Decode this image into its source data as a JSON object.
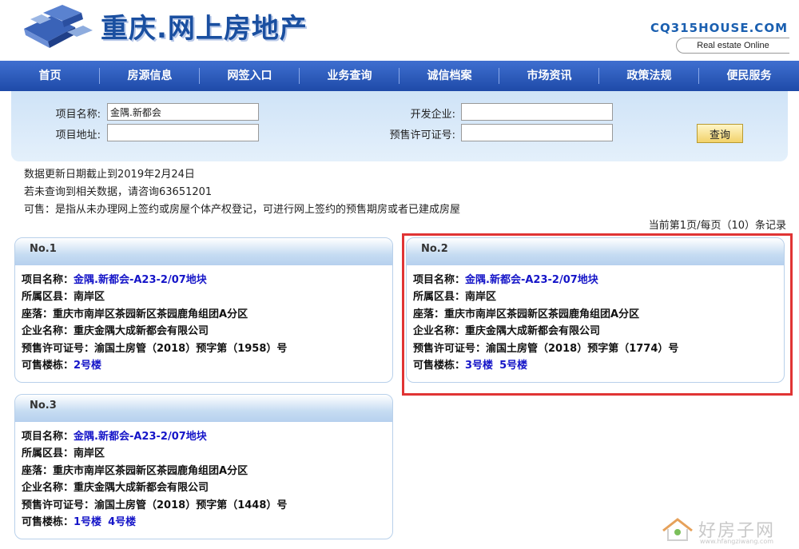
{
  "header": {
    "site_title": "重庆.网上房地产",
    "domain": "CQ315HOUSE.COM",
    "tagline": "Real estate Online"
  },
  "nav": {
    "items": [
      "首页",
      "房源信息",
      "网签入口",
      "业务查询",
      "诚信档案",
      "市场资讯",
      "政策法规",
      "便民服务"
    ]
  },
  "search": {
    "project_name_label": "项目名称:",
    "project_name_value": "金隅.新都会",
    "project_address_label": "项目地址:",
    "project_address_value": "",
    "developer_label": "开发企业:",
    "developer_value": "",
    "presale_permit_label": "预售许可证号:",
    "presale_permit_value": "",
    "query_button": "查询"
  },
  "info": {
    "update_date": "数据更新日期截止到2019年2月24日",
    "no_result_hint": "若未查询到相关数据，请咨询63651201",
    "available_definition": "可售：是指从未办理网上签约或房屋个体产权登记，可进行网上签约的预售期房或者已建成房屋",
    "page_info": "当前第1页/每页（10）条记录"
  },
  "labels": {
    "project_name": "项目名称：",
    "district": "所属区县：",
    "location": "座落：",
    "company": "企业名称：",
    "permit": "预售许可证号：",
    "buildings": "可售楼栋："
  },
  "cards": [
    {
      "no": "No.1",
      "project_name": "金隅.新都会-A23-2/07地块",
      "district": "南岸区",
      "location": "重庆市南岸区茶园新区茶园鹿角组团A分区",
      "company": "重庆金隅大成新都会有限公司",
      "permit": "渝国土房管（2018）预字第（1958）号",
      "buildings": [
        "2号楼"
      ]
    },
    {
      "no": "No.2",
      "project_name": "金隅.新都会-A23-2/07地块",
      "district": "南岸区",
      "location": "重庆市南岸区茶园新区茶园鹿角组团A分区",
      "company": "重庆金隅大成新都会有限公司",
      "permit": "渝国土房管（2018）预字第（1774）号",
      "buildings": [
        "3号楼",
        "5号楼"
      ]
    },
    {
      "no": "No.3",
      "project_name": "金隅.新都会-A23-2/07地块",
      "district": "南岸区",
      "location": "重庆市南岸区茶园新区茶园鹿角组团A分区",
      "company": "重庆金隅大成新都会有限公司",
      "permit": "渝国土房管（2018）预字第（1448）号",
      "buildings": [
        "1号楼",
        "4号楼"
      ]
    }
  ],
  "watermark": {
    "text": "好房子网",
    "url": "www.hfangziwang.com"
  },
  "colors": {
    "nav_bg": "#2a58b8",
    "link": "#1515c8",
    "highlight_border": "#e03434",
    "panel_bg": "#d8e8f8"
  }
}
